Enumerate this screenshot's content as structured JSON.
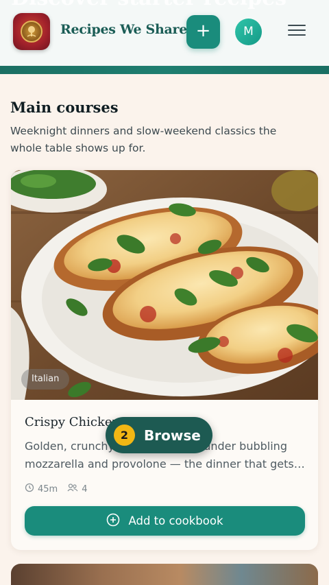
{
  "header": {
    "ghost_title": "Discover starter recipes",
    "brand": "Recipes We Share",
    "add_label": "+",
    "avatar_initial": "M",
    "logo_icon": "tree-medallion-icon",
    "menu_icon": "hamburger-menu-icon"
  },
  "section": {
    "title": "Main courses",
    "description": "Weeknight dinners and slow-weekend classics the whole table shows up for."
  },
  "cards": [
    {
      "tag": "Italian",
      "title": "Crispy Chicken Parmesan",
      "description_line1": "Golden, crunchy chicken cutlets under bubbling",
      "description_line2": "mozzarella and provolone — the dinner that gets…",
      "time": "45m",
      "servings": "4",
      "cta_label": "Add to cookbook"
    }
  ],
  "floating": {
    "step": "2",
    "label": "Browse"
  },
  "colors": {
    "accent": "#1a8c7c",
    "brand_text": "#1b5d56",
    "badge": "#f2b714",
    "background": "#fbf3ec"
  }
}
